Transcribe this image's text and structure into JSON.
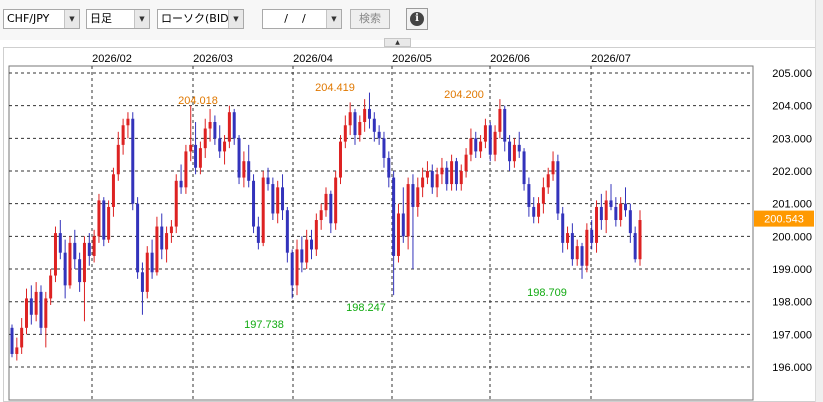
{
  "toolbar": {
    "pair": "CHF/JPY",
    "timeframe": "日足",
    "chart_kind": "ローソク(BID)",
    "date_value": "/    /",
    "search_label": "検索",
    "info_label": "i"
  },
  "colors": {
    "up": "#dd2222",
    "down": "#3333bb",
    "high_label": "#e07800",
    "low_label": "#11aa11",
    "current_price_bg": "#ff9900",
    "grid": "#333333"
  },
  "chart_data": {
    "type": "candlestick",
    "x_ticks": [
      "2026/02",
      "2026/03",
      "2026/04",
      "2026/05",
      "2026/06",
      "2026/07"
    ],
    "y_ticks": [
      "205.000",
      "204.000",
      "203.000",
      "202.000",
      "201.000",
      "200.000",
      "199.000",
      "198.000",
      "197.000",
      "196.000"
    ],
    "ylim": [
      195.7,
      205.25
    ],
    "current_price": "200.543",
    "annotations": {
      "highs": [
        "204.018",
        "204.419",
        "204.200"
      ],
      "lows": [
        "197.738",
        "198.247",
        "198.709"
      ]
    },
    "candles": [
      [
        197.2,
        197.3,
        196.3,
        196.4
      ],
      [
        196.4,
        196.9,
        196.2,
        196.6
      ],
      [
        196.6,
        197.5,
        196.4,
        197.2
      ],
      [
        197.2,
        198.4,
        197.0,
        198.1
      ],
      [
        198.1,
        198.5,
        197.3,
        197.6
      ],
      [
        197.6,
        198.6,
        197.4,
        198.3
      ],
      [
        198.3,
        198.5,
        197.0,
        197.2
      ],
      [
        197.2,
        198.3,
        196.6,
        198.1
      ],
      [
        198.1,
        199.0,
        197.9,
        198.8
      ],
      [
        198.8,
        200.3,
        198.6,
        200.1
      ],
      [
        200.1,
        200.5,
        199.3,
        199.5
      ],
      [
        199.5,
        199.9,
        198.1,
        198.5
      ],
      [
        198.5,
        200.0,
        198.4,
        199.8
      ],
      [
        199.8,
        200.2,
        199.0,
        199.3
      ],
      [
        199.3,
        199.5,
        198.3,
        198.6
      ],
      [
        198.6,
        200.0,
        197.4,
        199.8
      ],
      [
        199.8,
        200.1,
        199.1,
        199.4
      ],
      [
        199.4,
        200.2,
        199.2,
        200.0
      ],
      [
        200.0,
        201.3,
        199.8,
        201.1
      ],
      [
        201.1,
        201.2,
        199.7,
        199.9
      ],
      [
        199.9,
        201.1,
        199.8,
        200.9
      ],
      [
        200.9,
        202.1,
        200.6,
        201.9
      ],
      [
        201.9,
        203.2,
        201.7,
        202.8
      ],
      [
        202.8,
        203.6,
        202.5,
        203.4
      ],
      [
        203.4,
        203.8,
        203.0,
        203.6
      ],
      [
        203.6,
        203.8,
        200.8,
        201.0
      ],
      [
        201.0,
        201.2,
        198.7,
        198.9
      ],
      [
        198.9,
        199.2,
        197.6,
        198.3
      ],
      [
        198.3,
        199.7,
        198.1,
        199.5
      ],
      [
        199.5,
        199.9,
        198.7,
        198.9
      ],
      [
        198.9,
        200.6,
        198.8,
        200.3
      ],
      [
        200.3,
        200.7,
        199.3,
        199.6
      ],
      [
        199.6,
        200.3,
        199.2,
        200.1
      ],
      [
        200.1,
        200.5,
        199.8,
        200.3
      ],
      [
        200.3,
        201.9,
        200.1,
        201.7
      ],
      [
        201.7,
        202.2,
        201.3,
        201.5
      ],
      [
        201.5,
        202.8,
        201.3,
        202.6
      ],
      [
        202.6,
        204.0,
        202.3,
        202.8
      ],
      [
        202.8,
        203.5,
        201.9,
        202.1
      ],
      [
        202.1,
        202.9,
        201.9,
        202.7
      ],
      [
        202.7,
        203.6,
        202.4,
        203.3
      ],
      [
        203.3,
        203.9,
        202.9,
        203.5
      ],
      [
        203.5,
        203.7,
        202.8,
        203.0
      ],
      [
        203.0,
        203.4,
        202.4,
        202.6
      ],
      [
        202.6,
        203.1,
        202.2,
        202.9
      ],
      [
        202.9,
        204.0,
        202.7,
        203.8
      ],
      [
        203.8,
        203.9,
        202.8,
        203.0
      ],
      [
        203.0,
        203.1,
        201.6,
        201.8
      ],
      [
        201.8,
        202.6,
        201.5,
        202.3
      ],
      [
        202.3,
        202.8,
        201.5,
        201.7
      ],
      [
        201.7,
        201.9,
        200.1,
        200.3
      ],
      [
        200.3,
        200.6,
        199.6,
        199.8
      ],
      [
        199.8,
        202.0,
        199.7,
        201.8
      ],
      [
        201.8,
        202.1,
        201.4,
        201.6
      ],
      [
        201.6,
        201.8,
        200.5,
        200.7
      ],
      [
        200.7,
        201.7,
        200.4,
        201.5
      ],
      [
        201.5,
        201.9,
        200.5,
        200.8
      ],
      [
        200.8,
        200.9,
        199.2,
        199.5
      ],
      [
        199.5,
        199.6,
        198.1,
        198.5
      ],
      [
        198.5,
        199.9,
        198.2,
        199.6
      ],
      [
        199.6,
        200.0,
        198.9,
        199.2
      ],
      [
        199.2,
        200.2,
        199.0,
        199.9
      ],
      [
        199.9,
        200.2,
        199.3,
        199.6
      ],
      [
        199.6,
        200.7,
        199.4,
        200.5
      ],
      [
        200.5,
        201.0,
        200.2,
        200.8
      ],
      [
        200.8,
        201.5,
        200.6,
        201.3
      ],
      [
        201.3,
        201.4,
        200.1,
        200.4
      ],
      [
        200.4,
        202.0,
        200.2,
        201.8
      ],
      [
        201.8,
        203.1,
        201.6,
        202.9
      ],
      [
        202.9,
        203.7,
        202.7,
        203.4
      ],
      [
        203.4,
        204.1,
        203.1,
        203.8
      ],
      [
        203.8,
        203.9,
        202.8,
        203.1
      ],
      [
        203.1,
        203.7,
        202.9,
        203.5
      ],
      [
        203.5,
        204.2,
        203.2,
        203.9
      ],
      [
        203.9,
        204.4,
        203.3,
        203.6
      ],
      [
        203.6,
        203.8,
        202.9,
        203.2
      ],
      [
        203.2,
        203.4,
        202.8,
        203.0
      ],
      [
        203.0,
        203.2,
        202.1,
        202.4
      ],
      [
        202.4,
        202.6,
        201.5,
        201.8
      ],
      [
        201.8,
        202.0,
        198.2,
        199.4
      ],
      [
        199.4,
        201.0,
        199.2,
        200.7
      ],
      [
        200.7,
        201.5,
        199.8,
        200.0
      ],
      [
        200.0,
        201.8,
        199.6,
        201.6
      ],
      [
        201.6,
        201.9,
        199.0,
        200.9
      ],
      [
        200.9,
        201.8,
        200.6,
        201.5
      ],
      [
        201.5,
        202.1,
        201.2,
        201.8
      ],
      [
        201.8,
        202.3,
        201.6,
        202.0
      ],
      [
        202.0,
        202.2,
        201.3,
        201.5
      ],
      [
        201.5,
        202.1,
        201.2,
        201.9
      ],
      [
        201.9,
        202.4,
        201.6,
        202.1
      ],
      [
        202.1,
        202.3,
        201.4,
        201.6
      ],
      [
        201.6,
        202.5,
        201.4,
        202.3
      ],
      [
        202.3,
        202.4,
        201.4,
        201.6
      ],
      [
        201.6,
        202.2,
        201.4,
        202.0
      ],
      [
        202.0,
        202.7,
        201.8,
        202.5
      ],
      [
        202.5,
        203.3,
        202.3,
        203.0
      ],
      [
        203.0,
        203.2,
        202.4,
        202.6
      ],
      [
        202.6,
        203.1,
        202.4,
        202.9
      ],
      [
        202.9,
        203.6,
        202.7,
        203.4
      ],
      [
        203.4,
        203.5,
        202.3,
        202.5
      ],
      [
        202.5,
        203.4,
        202.3,
        203.2
      ],
      [
        203.2,
        204.2,
        203.0,
        203.9
      ],
      [
        203.9,
        204.0,
        202.6,
        202.9
      ],
      [
        202.9,
        203.1,
        202.0,
        202.3
      ],
      [
        202.3,
        203.0,
        202.1,
        202.8
      ],
      [
        202.8,
        203.2,
        202.4,
        202.6
      ],
      [
        202.6,
        202.7,
        201.4,
        201.6
      ],
      [
        201.6,
        201.8,
        200.6,
        200.9
      ],
      [
        200.9,
        201.2,
        200.4,
        200.6
      ],
      [
        200.6,
        201.2,
        200.4,
        201.0
      ],
      [
        201.0,
        201.8,
        200.7,
        201.5
      ],
      [
        201.5,
        202.1,
        201.3,
        201.9
      ],
      [
        201.9,
        202.6,
        201.7,
        202.3
      ],
      [
        202.3,
        202.5,
        200.5,
        200.7
      ],
      [
        200.7,
        200.9,
        199.5,
        199.8
      ],
      [
        199.8,
        200.3,
        199.6,
        200.1
      ],
      [
        200.1,
        200.4,
        199.1,
        199.3
      ],
      [
        199.3,
        199.9,
        199.1,
        199.7
      ],
      [
        199.7,
        199.8,
        198.7,
        199.1
      ],
      [
        199.1,
        200.4,
        198.9,
        200.2
      ],
      [
        200.2,
        200.5,
        199.6,
        199.8
      ],
      [
        199.8,
        201.1,
        199.5,
        200.9
      ],
      [
        200.9,
        201.3,
        200.2,
        200.5
      ],
      [
        200.5,
        201.4,
        200.1,
        201.1
      ],
      [
        201.1,
        201.6,
        200.8,
        200.9
      ],
      [
        200.9,
        201.2,
        200.3,
        200.5
      ],
      [
        200.5,
        201.2,
        200.3,
        201.0
      ],
      [
        201.0,
        201.5,
        200.6,
        200.8
      ],
      [
        200.8,
        201.0,
        199.8,
        200.1
      ],
      [
        200.1,
        200.3,
        199.2,
        199.3
      ],
      [
        199.3,
        200.8,
        199.1,
        200.5
      ]
    ]
  }
}
